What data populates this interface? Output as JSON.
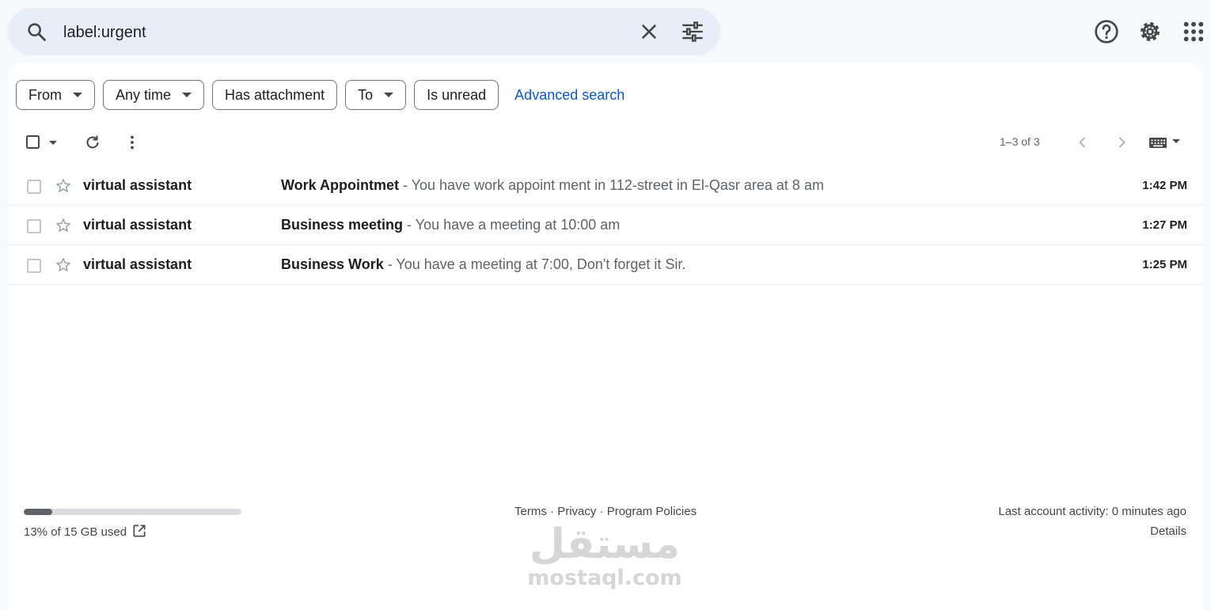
{
  "search": {
    "query": "label:urgent",
    "search_icon": "search-icon",
    "clear_icon": "close-icon",
    "options_icon": "tune-icon"
  },
  "header_icons": [
    "help-icon",
    "gear-icon",
    "apps-grid-icon"
  ],
  "filters": {
    "chips": [
      {
        "label": "From",
        "dropdown": true
      },
      {
        "label": "Any time",
        "dropdown": true
      },
      {
        "label": "Has attachment",
        "dropdown": false
      },
      {
        "label": "To",
        "dropdown": true
      },
      {
        "label": "Is unread",
        "dropdown": false
      }
    ],
    "advanced_search": "Advanced search"
  },
  "toolbar": {
    "range": "1–3 of 3"
  },
  "emails": [
    {
      "sender": "virtual assistant",
      "subject": "Work Appointmet",
      "snippet": " - You have work appoint ment in 112-street in El-Qasr area at 8 am",
      "time": "1:42 PM"
    },
    {
      "sender": "virtual assistant",
      "subject": "Business meeting",
      "snippet": " - You have a meeting at 10:00 am",
      "time": "1:27 PM"
    },
    {
      "sender": "virtual assistant",
      "subject": "Business Work",
      "snippet": " - You have a meeting at 7:00, Don't forget it Sir.",
      "time": "1:25 PM"
    }
  ],
  "footer": {
    "storage_text": "13% of 15 GB used",
    "storage_fraction": 0.13,
    "terms": "Terms",
    "privacy": "Privacy",
    "policies": "Program Policies",
    "sep": " · ",
    "activity": "Last account activity: 0 minutes ago",
    "details": "Details"
  },
  "watermark": {
    "arabic": "مستقل",
    "latin": "mostaql.com"
  },
  "colors": {
    "page_bg": "#f6f8fc",
    "search_bg": "#e9eef6",
    "link": "#0b57d0"
  }
}
